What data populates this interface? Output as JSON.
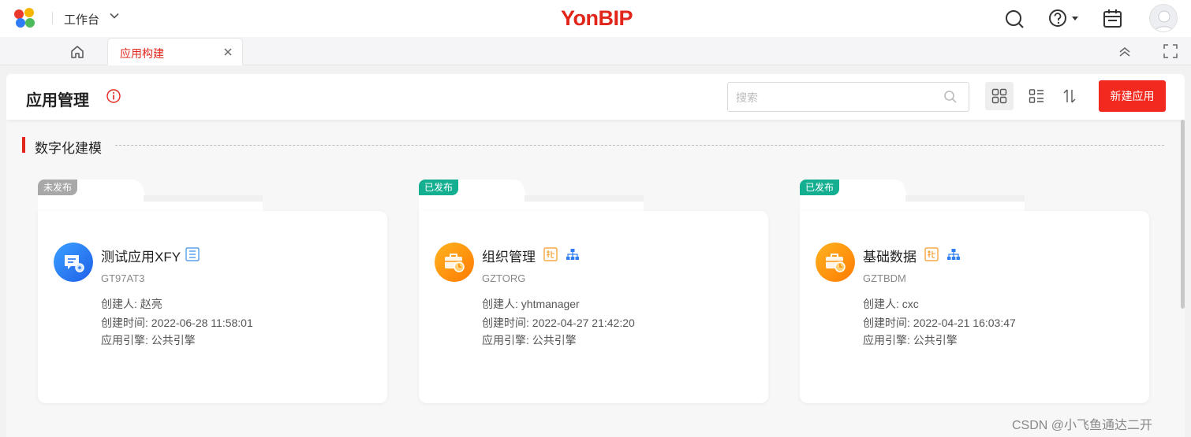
{
  "topbar": {
    "workspace_label": "工作台",
    "brand": "YonBIP",
    "icons": [
      "logo-icon",
      "chevron-down-icon",
      "search-icon",
      "help-icon",
      "calendar-icon",
      "avatar-icon"
    ]
  },
  "tabs": [
    {
      "label": "应用构建",
      "active": true
    }
  ],
  "header": {
    "title": "应用管理",
    "search_placeholder": "搜索",
    "new_button": "新建应用"
  },
  "section": {
    "title": "数字化建模"
  },
  "meta_labels": {
    "creator": "创建人: ",
    "created_time": "创建时间: ",
    "engine": "应用引擎: "
  },
  "cards": [
    {
      "status": "未发布",
      "name": "测试应用XFY",
      "code": "GT97AT3",
      "creator": "赵亮",
      "created_time": "2022-06-28 11:58:01",
      "engine": "公共引擎",
      "icon": "blue-doc-gear-icon",
      "tags": [
        "doc-tag-icon"
      ]
    },
    {
      "status": "已发布",
      "name": "组织管理",
      "code": "GZTORG",
      "creator": "yhtmanager",
      "created_time": "2022-04-27 21:42:20",
      "engine": "公共引擎",
      "icon": "orange-briefcase-icon",
      "tags": [
        "extend-tag-icon",
        "org-tree-icon"
      ]
    },
    {
      "status": "已发布",
      "name": "基础数据",
      "code": "GZTBDM",
      "creator": "cxc",
      "created_time": "2022-04-21 16:03:47",
      "engine": "公共引擎",
      "icon": "orange-briefcase-icon",
      "tags": [
        "extend-tag-icon",
        "org-tree-icon"
      ]
    }
  ],
  "colors": {
    "brand_red": "#e1251b",
    "published_green": "#14ae91",
    "draft_gray": "#a8a8a8"
  },
  "watermark": "CSDN @小飞鱼通达二开"
}
